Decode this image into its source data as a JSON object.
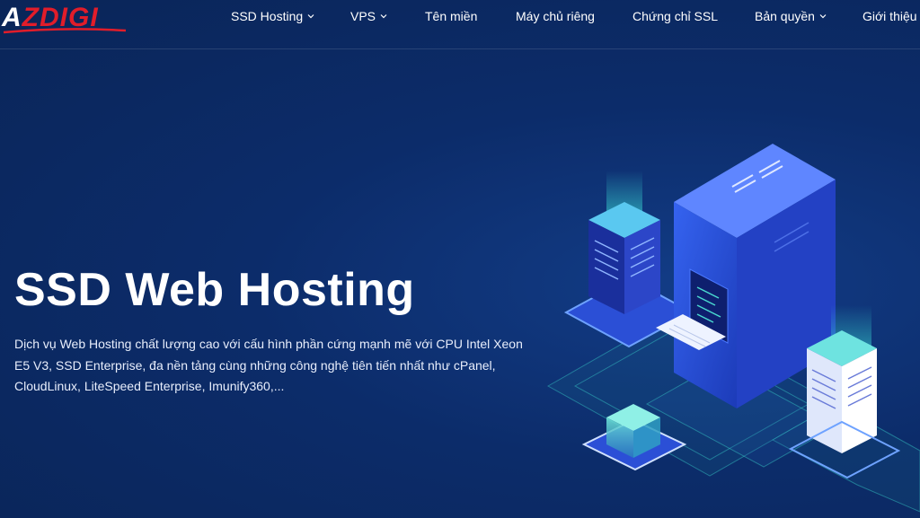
{
  "logo": {
    "part_a": "A",
    "part_z": "Z",
    "part_digi": "DIGI"
  },
  "nav": {
    "items": [
      {
        "label": "SSD Hosting",
        "has_dropdown": true
      },
      {
        "label": "VPS",
        "has_dropdown": true
      },
      {
        "label": "Tên miền",
        "has_dropdown": false
      },
      {
        "label": "Máy chủ riêng",
        "has_dropdown": false
      },
      {
        "label": "Chứng chỉ SSL",
        "has_dropdown": false
      },
      {
        "label": "Bản quyền",
        "has_dropdown": true
      },
      {
        "label": "Giới thiệu",
        "has_dropdown": false
      }
    ]
  },
  "hero": {
    "title": "SSD Web Hosting",
    "description": "Dịch vụ Web Hosting chất lượng cao với cấu hình phần cứng mạnh mẽ với CPU Intel Xeon E5 V3, SSD Enterprise, đa nền tảng cùng những công nghệ tiên tiến nhất như cPanel, CloudLinux, LiteSpeed Enterprise, Imunify360,..."
  },
  "colors": {
    "background": "#0c2c6a",
    "brand_red": "#e11d2a",
    "server_blue": "#2e57e6",
    "accent_cyan": "#38d5d0"
  }
}
